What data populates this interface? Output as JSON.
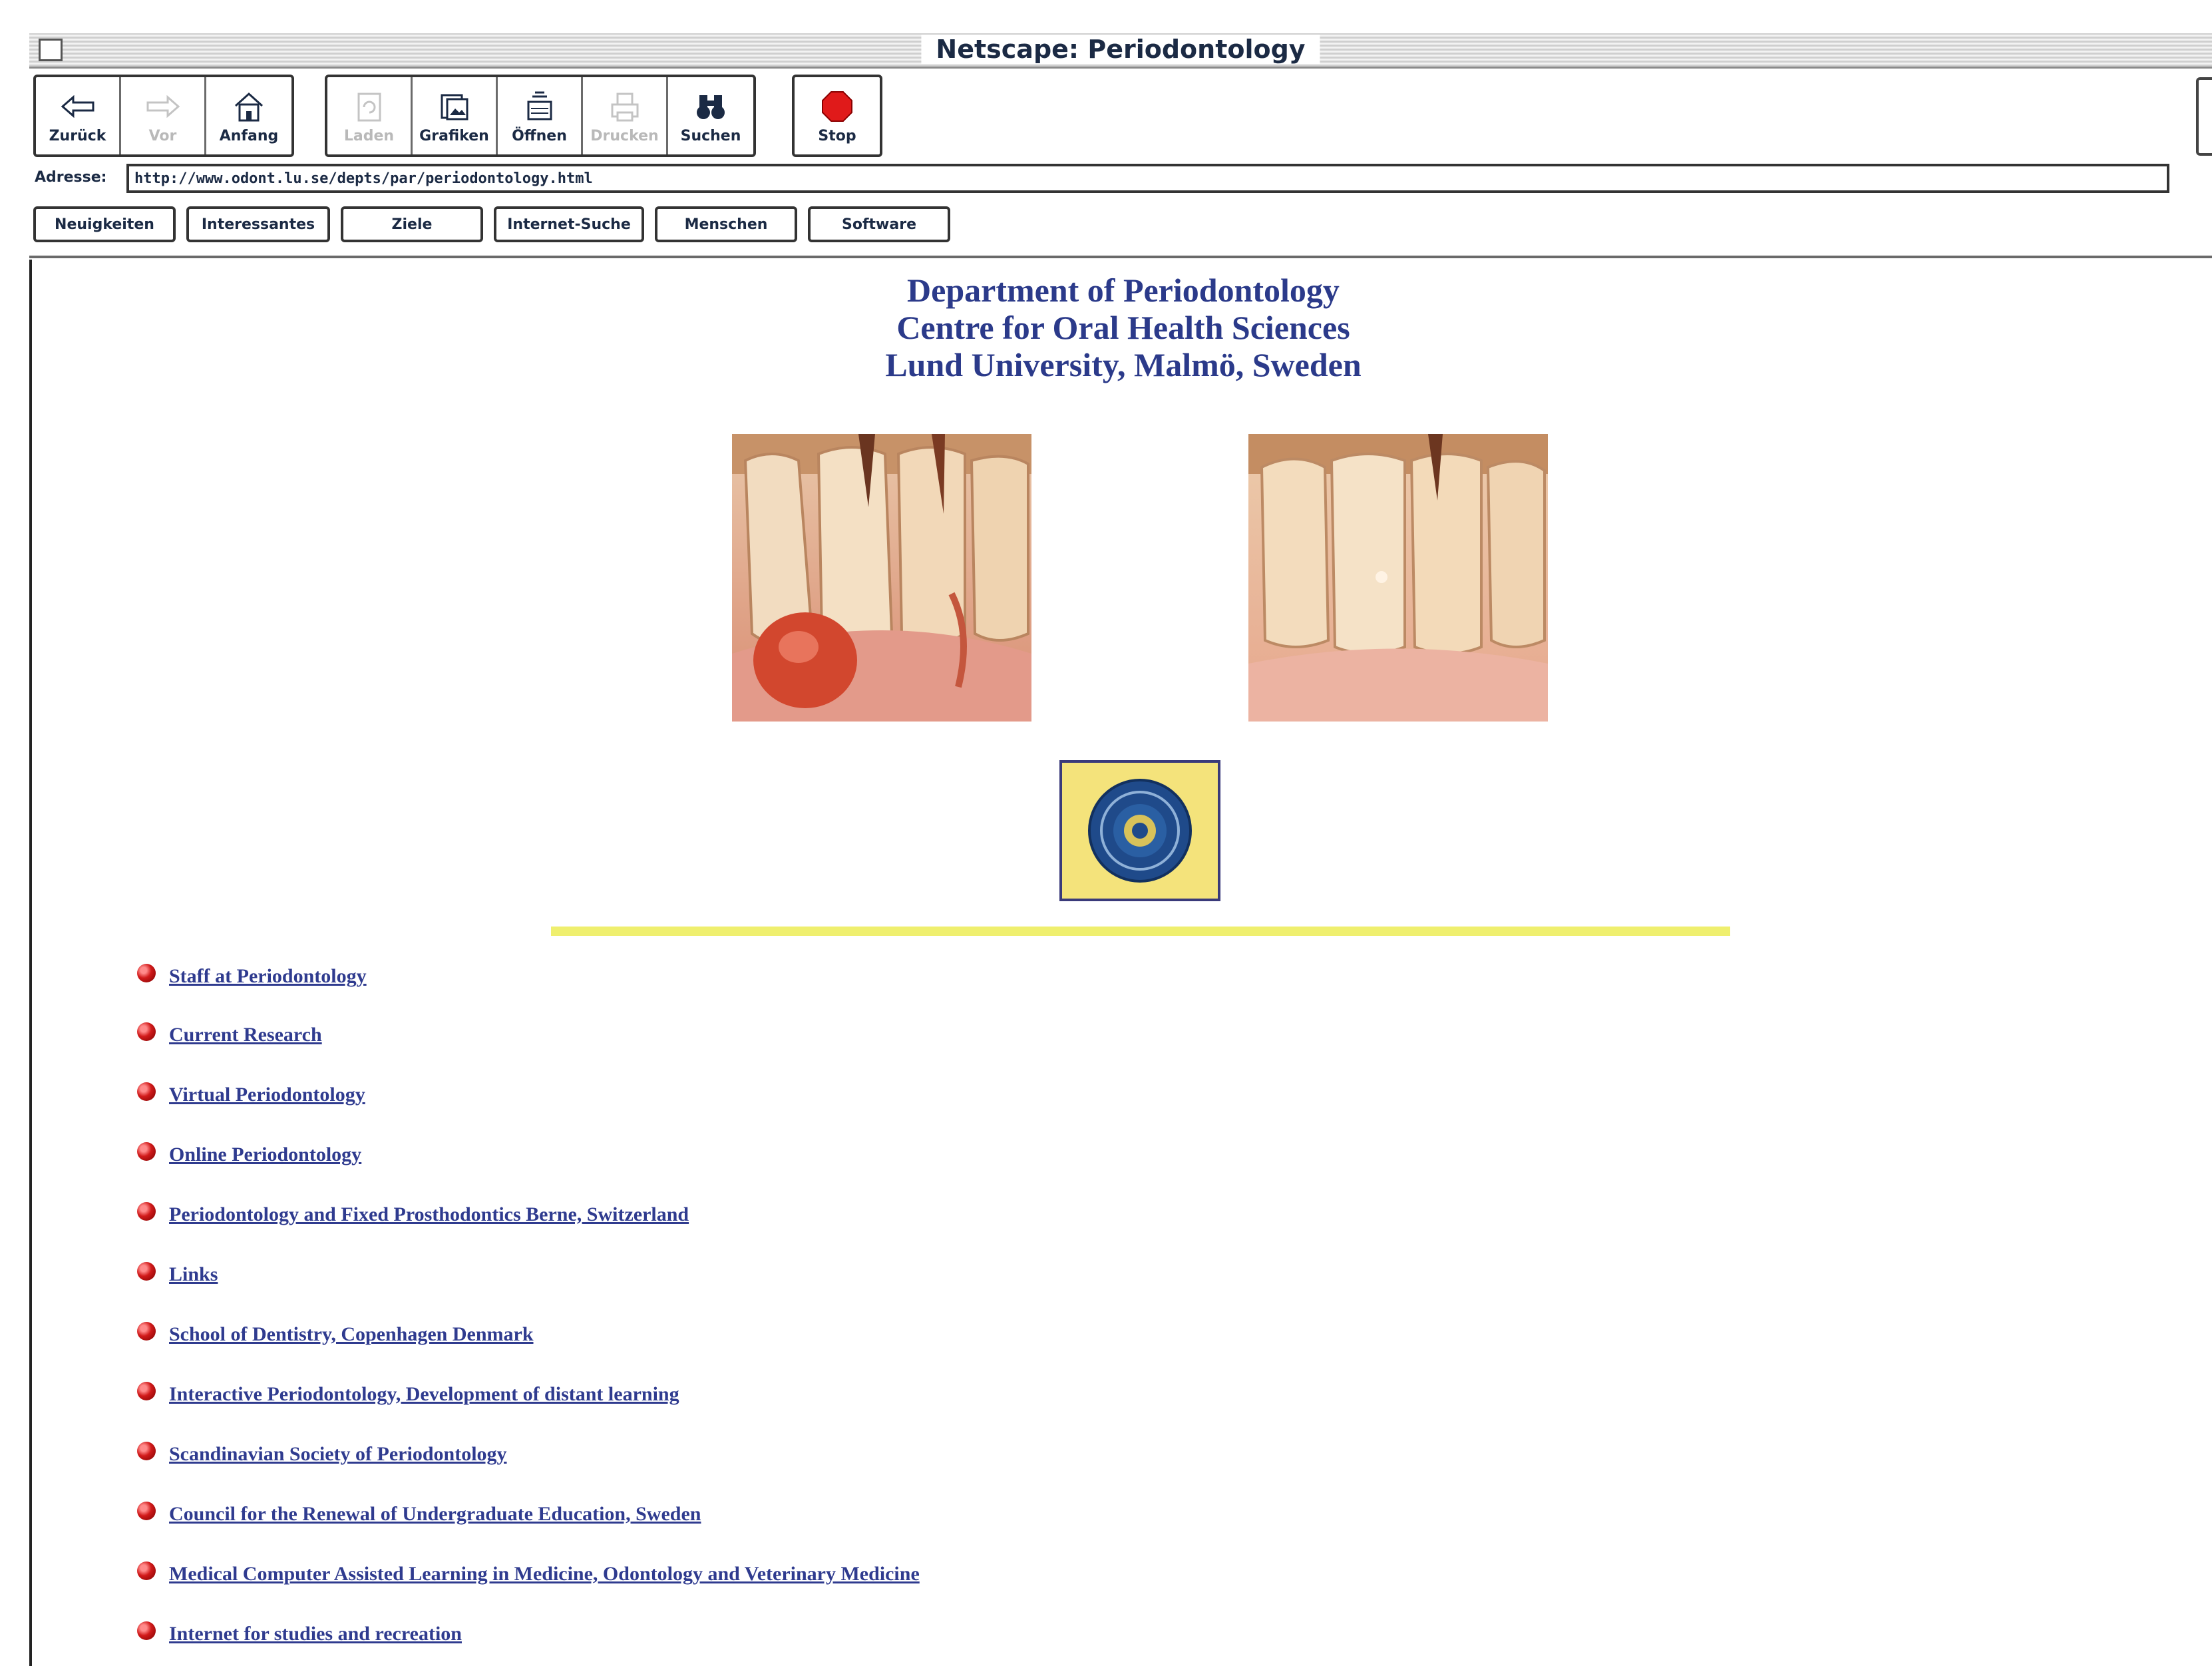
{
  "window": {
    "title": "Netscape: Periodontology"
  },
  "toolbar": {
    "buttons": [
      {
        "label": "Zurück",
        "icon": "back-arrow-icon",
        "enabled": true
      },
      {
        "label": "Vor",
        "icon": "forward-arrow-icon",
        "enabled": false
      },
      {
        "label": "Anfang",
        "icon": "home-icon",
        "enabled": true
      },
      {
        "label": "Laden",
        "icon": "reload-icon",
        "enabled": false
      },
      {
        "label": "Grafiken",
        "icon": "images-icon",
        "enabled": true
      },
      {
        "label": "Öffnen",
        "icon": "open-icon",
        "enabled": true
      },
      {
        "label": "Drucken",
        "icon": "print-icon",
        "enabled": false
      },
      {
        "label": "Suchen",
        "icon": "binoculars-icon",
        "enabled": true
      },
      {
        "label": "Stop",
        "icon": "stop-icon",
        "enabled": true
      }
    ]
  },
  "address": {
    "label": "Adresse:",
    "url": "http://www.odont.lu.se/depts/par/periodontology.html"
  },
  "directory_buttons": [
    "Neuigkeiten",
    "Interessantes",
    "Ziele",
    "Internet-Suche",
    "Menschen",
    "Software"
  ],
  "page": {
    "heading": [
      "Department of Periodontology",
      "Centre for Oral Health Sciences",
      "Lund University, Malmö, Sweden"
    ],
    "links": [
      "Staff at Periodontology",
      "Current Research",
      "Virtual Periodontology",
      "Online Periodontology",
      "Periodontology and Fixed Prosthodontics Berne, Switzerland",
      "Links",
      "School of Dentistry, Copenhagen Denmark",
      "Interactive Periodontology, Development of distant learning",
      "Scandinavian Society of Periodontology",
      "Council for the Renewal of Undergraduate Education, Sweden",
      "Medical Computer Assisted Learning in Medicine, Odontology and Veterinary Medicine",
      "Internet for studies and recreation"
    ]
  },
  "colors": {
    "link": "#2f3b8f",
    "heading": "#2b3a8a",
    "rule": "#efef6e",
    "bullet": "#d11a1a"
  }
}
